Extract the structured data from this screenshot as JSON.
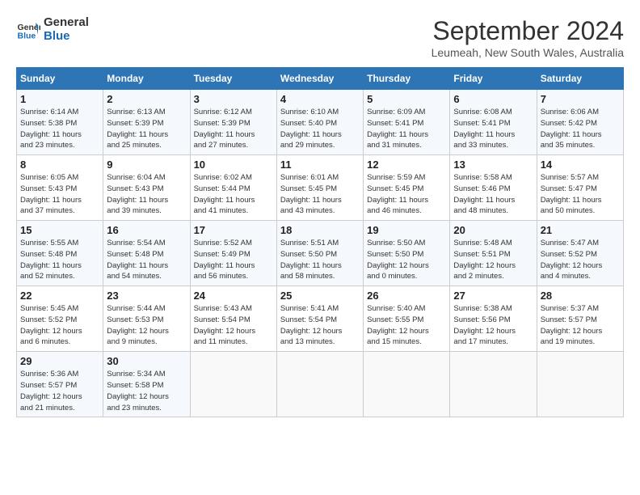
{
  "header": {
    "logo_line1": "General",
    "logo_line2": "Blue",
    "month": "September 2024",
    "location": "Leumeah, New South Wales, Australia"
  },
  "weekdays": [
    "Sunday",
    "Monday",
    "Tuesday",
    "Wednesday",
    "Thursday",
    "Friday",
    "Saturday"
  ],
  "weeks": [
    [
      {
        "day": "1",
        "info": "Sunrise: 6:14 AM\nSunset: 5:38 PM\nDaylight: 11 hours\nand 23 minutes."
      },
      {
        "day": "2",
        "info": "Sunrise: 6:13 AM\nSunset: 5:39 PM\nDaylight: 11 hours\nand 25 minutes."
      },
      {
        "day": "3",
        "info": "Sunrise: 6:12 AM\nSunset: 5:39 PM\nDaylight: 11 hours\nand 27 minutes."
      },
      {
        "day": "4",
        "info": "Sunrise: 6:10 AM\nSunset: 5:40 PM\nDaylight: 11 hours\nand 29 minutes."
      },
      {
        "day": "5",
        "info": "Sunrise: 6:09 AM\nSunset: 5:41 PM\nDaylight: 11 hours\nand 31 minutes."
      },
      {
        "day": "6",
        "info": "Sunrise: 6:08 AM\nSunset: 5:41 PM\nDaylight: 11 hours\nand 33 minutes."
      },
      {
        "day": "7",
        "info": "Sunrise: 6:06 AM\nSunset: 5:42 PM\nDaylight: 11 hours\nand 35 minutes."
      }
    ],
    [
      {
        "day": "8",
        "info": "Sunrise: 6:05 AM\nSunset: 5:43 PM\nDaylight: 11 hours\nand 37 minutes."
      },
      {
        "day": "9",
        "info": "Sunrise: 6:04 AM\nSunset: 5:43 PM\nDaylight: 11 hours\nand 39 minutes."
      },
      {
        "day": "10",
        "info": "Sunrise: 6:02 AM\nSunset: 5:44 PM\nDaylight: 11 hours\nand 41 minutes."
      },
      {
        "day": "11",
        "info": "Sunrise: 6:01 AM\nSunset: 5:45 PM\nDaylight: 11 hours\nand 43 minutes."
      },
      {
        "day": "12",
        "info": "Sunrise: 5:59 AM\nSunset: 5:45 PM\nDaylight: 11 hours\nand 46 minutes."
      },
      {
        "day": "13",
        "info": "Sunrise: 5:58 AM\nSunset: 5:46 PM\nDaylight: 11 hours\nand 48 minutes."
      },
      {
        "day": "14",
        "info": "Sunrise: 5:57 AM\nSunset: 5:47 PM\nDaylight: 11 hours\nand 50 minutes."
      }
    ],
    [
      {
        "day": "15",
        "info": "Sunrise: 5:55 AM\nSunset: 5:48 PM\nDaylight: 11 hours\nand 52 minutes."
      },
      {
        "day": "16",
        "info": "Sunrise: 5:54 AM\nSunset: 5:48 PM\nDaylight: 11 hours\nand 54 minutes."
      },
      {
        "day": "17",
        "info": "Sunrise: 5:52 AM\nSunset: 5:49 PM\nDaylight: 11 hours\nand 56 minutes."
      },
      {
        "day": "18",
        "info": "Sunrise: 5:51 AM\nSunset: 5:50 PM\nDaylight: 11 hours\nand 58 minutes."
      },
      {
        "day": "19",
        "info": "Sunrise: 5:50 AM\nSunset: 5:50 PM\nDaylight: 12 hours\nand 0 minutes."
      },
      {
        "day": "20",
        "info": "Sunrise: 5:48 AM\nSunset: 5:51 PM\nDaylight: 12 hours\nand 2 minutes."
      },
      {
        "day": "21",
        "info": "Sunrise: 5:47 AM\nSunset: 5:52 PM\nDaylight: 12 hours\nand 4 minutes."
      }
    ],
    [
      {
        "day": "22",
        "info": "Sunrise: 5:45 AM\nSunset: 5:52 PM\nDaylight: 12 hours\nand 6 minutes."
      },
      {
        "day": "23",
        "info": "Sunrise: 5:44 AM\nSunset: 5:53 PM\nDaylight: 12 hours\nand 9 minutes."
      },
      {
        "day": "24",
        "info": "Sunrise: 5:43 AM\nSunset: 5:54 PM\nDaylight: 12 hours\nand 11 minutes."
      },
      {
        "day": "25",
        "info": "Sunrise: 5:41 AM\nSunset: 5:54 PM\nDaylight: 12 hours\nand 13 minutes."
      },
      {
        "day": "26",
        "info": "Sunrise: 5:40 AM\nSunset: 5:55 PM\nDaylight: 12 hours\nand 15 minutes."
      },
      {
        "day": "27",
        "info": "Sunrise: 5:38 AM\nSunset: 5:56 PM\nDaylight: 12 hours\nand 17 minutes."
      },
      {
        "day": "28",
        "info": "Sunrise: 5:37 AM\nSunset: 5:57 PM\nDaylight: 12 hours\nand 19 minutes."
      }
    ],
    [
      {
        "day": "29",
        "info": "Sunrise: 5:36 AM\nSunset: 5:57 PM\nDaylight: 12 hours\nand 21 minutes."
      },
      {
        "day": "30",
        "info": "Sunrise: 5:34 AM\nSunset: 5:58 PM\nDaylight: 12 hours\nand 23 minutes."
      },
      {
        "day": "",
        "info": ""
      },
      {
        "day": "",
        "info": ""
      },
      {
        "day": "",
        "info": ""
      },
      {
        "day": "",
        "info": ""
      },
      {
        "day": "",
        "info": ""
      }
    ]
  ]
}
